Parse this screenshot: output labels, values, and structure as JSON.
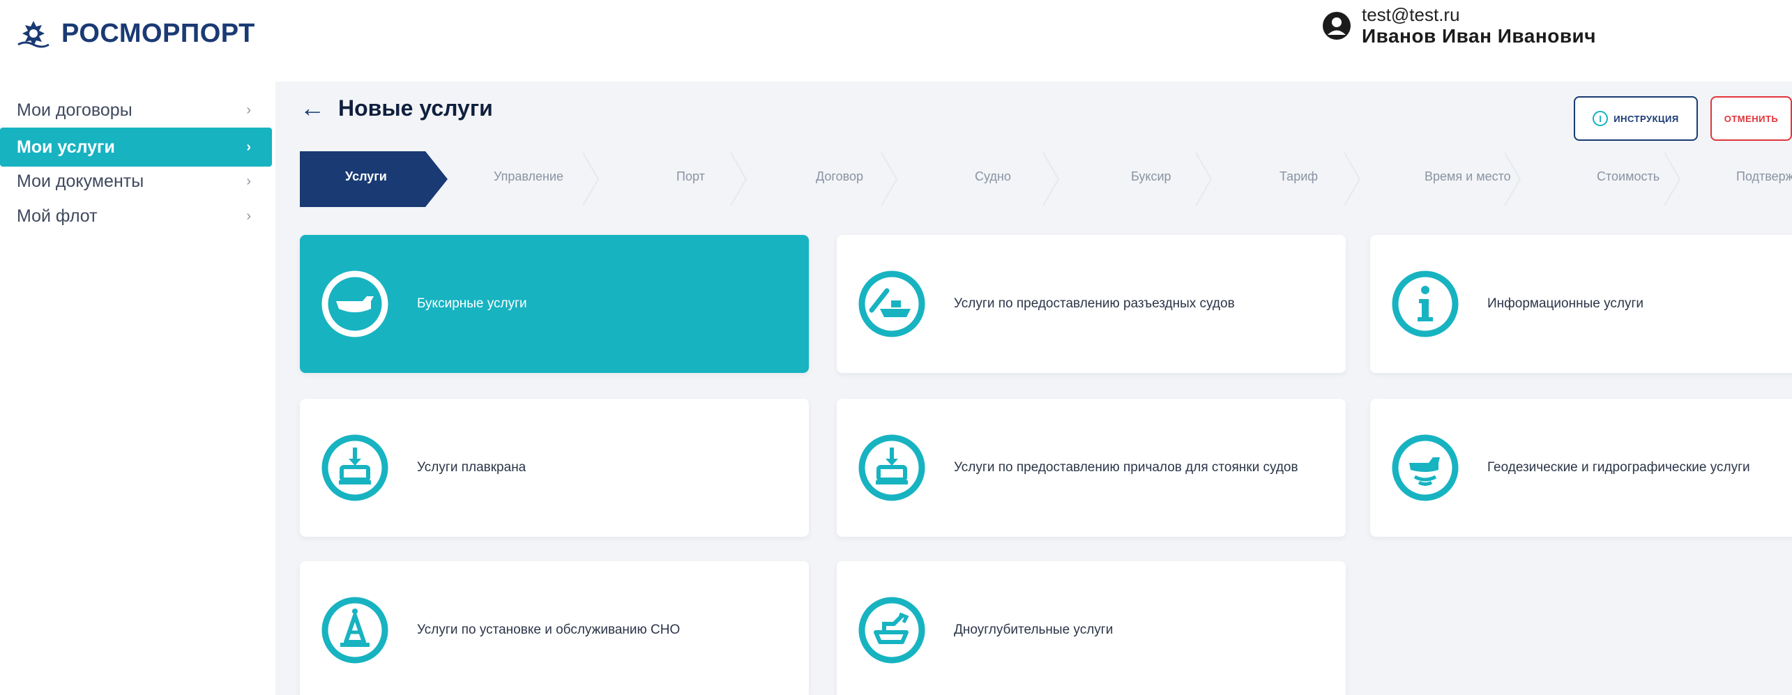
{
  "header": {
    "logo_text": "РОСМОРПОРТ",
    "user_email": "test@test.ru",
    "user_name": "Иванов Иван Иванович"
  },
  "sidebar": {
    "items": [
      {
        "label": "Мои договоры",
        "active": false
      },
      {
        "label": "Мои услуги",
        "active": true
      },
      {
        "label": "Мои документы",
        "active": false
      },
      {
        "label": "Мой флот",
        "active": false
      }
    ]
  },
  "page": {
    "back_icon": "arrow-left-icon",
    "title": "Новые услуги",
    "instructions_label": "инструкция",
    "cancel_label": "отменить"
  },
  "stepper": {
    "active_index": 0,
    "steps": [
      "Услуги",
      "Управление",
      "Порт",
      "Договор",
      "Судно",
      "Буксир",
      "Тариф",
      "Время и место",
      "Стоимость",
      "Подтверждение"
    ]
  },
  "services": [
    {
      "label": "Буксирные услуги",
      "icon": "tug-boat-icon",
      "active": true
    },
    {
      "label": "Услуги по предоставлению разъездных судов",
      "icon": "ferry-boat-icon",
      "active": false
    },
    {
      "label": "Информационные услуги",
      "icon": "info-icon",
      "active": false
    },
    {
      "label": "Услуги плавкрана",
      "icon": "floating-crane-icon",
      "active": false
    },
    {
      "label": "Услуги по предоставлению причалов для стоянки судов",
      "icon": "mooring-icon",
      "active": false
    },
    {
      "label": "Геодезические и гидрографические услуги",
      "icon": "hydrographic-survey-icon",
      "active": false
    },
    {
      "label": "Услуги по установке и обслуживанию СНО",
      "icon": "navigation-buoy-icon",
      "active": false
    },
    {
      "label": "Дноуглубительные услуги",
      "icon": "dredging-icon",
      "active": false
    }
  ],
  "colors": {
    "accent": "#17b3c1",
    "primary": "#1a3a74",
    "stepper_active": "#1a3a74",
    "cancel": "#e0363b",
    "main_bg": "#f2f4f7"
  }
}
